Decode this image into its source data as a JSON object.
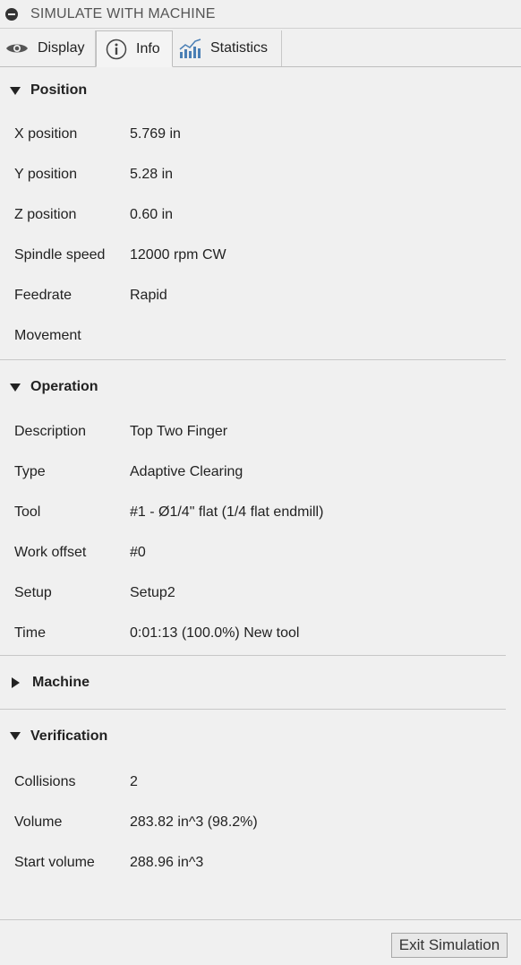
{
  "window": {
    "title": "SIMULATE WITH MACHINE"
  },
  "tabs": [
    {
      "label": "Display",
      "icon": "eye-icon"
    },
    {
      "label": "Info",
      "icon": "info-icon",
      "active": true
    },
    {
      "label": "Statistics",
      "icon": "bar-chart-icon"
    }
  ],
  "position": {
    "title": "Position",
    "rows": [
      {
        "label": "X position",
        "value": "5.769 in"
      },
      {
        "label": "Y position",
        "value": "5.28 in"
      },
      {
        "label": "Z position",
        "value": "0.60 in"
      },
      {
        "label": "Spindle speed",
        "value": "12000 rpm CW"
      },
      {
        "label": "Feedrate",
        "value": "Rapid"
      },
      {
        "label": "Movement",
        "value": ""
      }
    ]
  },
  "operation": {
    "title": "Operation",
    "rows": [
      {
        "label": "Description",
        "value": "Top Two Finger"
      },
      {
        "label": "Type",
        "value": "Adaptive Clearing"
      },
      {
        "label": "Tool",
        "value": "#1 - Ø1/4\" flat (1/4 flat endmill)"
      },
      {
        "label": "Work offset",
        "value": "#0"
      },
      {
        "label": "Setup",
        "value": "Setup2"
      },
      {
        "label": "Time",
        "value": "0:01:13 (100.0%) New tool"
      }
    ]
  },
  "machine": {
    "title": "Machine"
  },
  "verification": {
    "title": "Verification",
    "rows": [
      {
        "label": "Collisions",
        "value": "2"
      },
      {
        "label": "Volume",
        "value": "283.82 in^3 (98.2%)"
      },
      {
        "label": "Start volume",
        "value": "288.96 in^3"
      }
    ]
  },
  "footer": {
    "exit_label": "Exit Simulation"
  }
}
